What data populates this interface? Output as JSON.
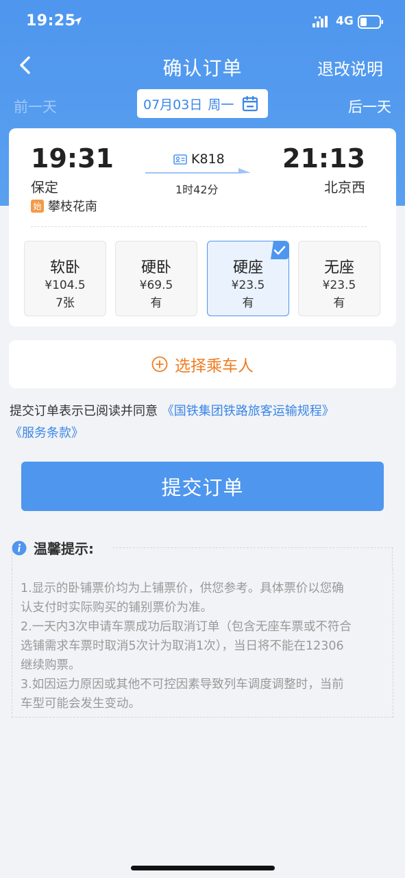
{
  "status_bar": {
    "time": "19:25",
    "network": "4G",
    "icons": [
      "location-arrow-icon",
      "signal-bars-icon",
      "battery-icon"
    ]
  },
  "nav": {
    "title": "确认订单",
    "right_label": "退改说明",
    "back_icon": "chevron-left-icon"
  },
  "date_bar": {
    "prev_label": "前一天",
    "next_label": "后一天",
    "date": "07月03日",
    "weekday": "周一",
    "calendar_icon": "calendar-icon"
  },
  "train": {
    "departure_time": "19:31",
    "departure_station": "保定",
    "origin_badge": "始",
    "origin_station": "攀枝花南",
    "train_number": "K818",
    "duration": "1时42分",
    "arrival_time": "21:13",
    "arrival_station": "北京西"
  },
  "seats": [
    {
      "name": "软卧",
      "price": "¥104.5",
      "availability": "7张",
      "selected": false
    },
    {
      "name": "硬卧",
      "price": "¥69.5",
      "availability": "有",
      "selected": false
    },
    {
      "name": "硬座",
      "price": "¥23.5",
      "availability": "有",
      "selected": true
    },
    {
      "name": "无座",
      "price": "¥23.5",
      "availability": "有",
      "selected": false
    }
  ],
  "passenger": {
    "label": "选择乘车人",
    "icon": "plus-circle-icon"
  },
  "agreement": {
    "prefix": "提交订单表示已阅读并同意",
    "link1": "《国铁集团铁路旅客运输规程》",
    "link2": "《服务条款》"
  },
  "submit_label": "提交订单",
  "tips": {
    "title": "温馨提示:",
    "icon": "info-icon",
    "lines": [
      "1.显示的卧铺票价均为上铺票价，供您参考。具体票价以您确",
      "认支付时实际购买的铺别票价为准。",
      "2.一天内3次申请车票成功后取消订单（包含无座车票或不符合",
      "选铺需求车票时取消5次计为取消1次），当日将不能在12306",
      "继续购票。",
      "3.如因运力原因或其他不可控因素导致列车调度调整时，当前",
      "车型可能会发生变动。"
    ]
  },
  "colors": {
    "primary": "#4e96ee",
    "accent_orange": "#f07d22",
    "link": "#3a86e8",
    "background": "#f2f3f6"
  }
}
